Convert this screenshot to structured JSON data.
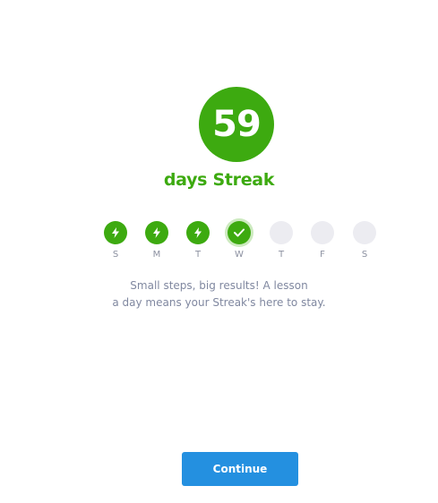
{
  "streak": {
    "count": "59",
    "label": "days Streak"
  },
  "week": [
    {
      "letter": "S",
      "status": "done",
      "icon": "lightning-icon"
    },
    {
      "letter": "M",
      "status": "done",
      "icon": "lightning-icon"
    },
    {
      "letter": "T",
      "status": "done",
      "icon": "lightning-icon"
    },
    {
      "letter": "W",
      "status": "today",
      "icon": "checkmark-icon"
    },
    {
      "letter": "T",
      "status": "empty",
      "icon": ""
    },
    {
      "letter": "F",
      "status": "empty",
      "icon": ""
    },
    {
      "letter": "S",
      "status": "empty",
      "icon": ""
    }
  ],
  "message": {
    "line1": "Small steps, big results! A lesson",
    "line2": "a day means your Streak's here to stay."
  },
  "continue_label": "Continue",
  "colors": {
    "accent_green": "#3daa10",
    "button_blue": "#2490e0",
    "empty_dot": "#ececf1",
    "muted_text": "#8088a0"
  }
}
